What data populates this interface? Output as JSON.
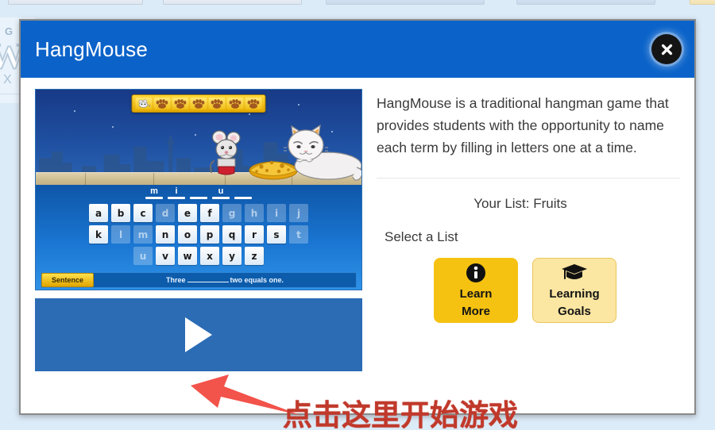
{
  "background": {
    "logo_letter": "W",
    "logo_g": "G",
    "logo_x": "X"
  },
  "modal": {
    "title": "HangMouse",
    "close_icon": "close-x-icon",
    "header_color": "#0b63c9"
  },
  "left_panel": {
    "preview": {
      "lives": [
        {
          "type": "mouse-icon"
        },
        {
          "type": "paw-icon"
        },
        {
          "type": "paw-icon"
        },
        {
          "type": "paw-icon"
        },
        {
          "type": "paw-icon"
        },
        {
          "type": "paw-icon"
        },
        {
          "type": "paw-icon"
        }
      ],
      "word_slots": [
        "m",
        "i",
        "",
        "u",
        ""
      ],
      "keyboard": [
        [
          {
            "letter": "a",
            "used": false
          },
          {
            "letter": "b",
            "used": false
          },
          {
            "letter": "c",
            "used": false
          },
          {
            "letter": "d",
            "used": true
          },
          {
            "letter": "e",
            "used": false
          },
          {
            "letter": "f",
            "used": false
          },
          {
            "letter": "g",
            "used": true
          },
          {
            "letter": "h",
            "used": true
          },
          {
            "letter": "i",
            "used": true
          },
          {
            "letter": "j",
            "used": true
          }
        ],
        [
          {
            "letter": "k",
            "used": false
          },
          {
            "letter": "l",
            "used": true
          },
          {
            "letter": "m",
            "used": true
          },
          {
            "letter": "n",
            "used": false
          },
          {
            "letter": "o",
            "used": false
          },
          {
            "letter": "p",
            "used": false
          },
          {
            "letter": "q",
            "used": false
          },
          {
            "letter": "r",
            "used": false
          },
          {
            "letter": "s",
            "used": false
          },
          {
            "letter": "t",
            "used": true
          }
        ],
        [
          {
            "letter": "u",
            "used": true
          },
          {
            "letter": "v",
            "used": false
          },
          {
            "letter": "w",
            "used": false
          },
          {
            "letter": "x",
            "used": false
          },
          {
            "letter": "y",
            "used": false
          },
          {
            "letter": "z",
            "used": false
          }
        ]
      ],
      "sentence_button_label": "Sentence",
      "sentence_prefix": "Three",
      "sentence_suffix": "two equals one."
    },
    "play_button": {
      "icon": "play-triangle-icon"
    }
  },
  "right_panel": {
    "description": "HangMouse is a traditional hangman game that provides students with the opportunity to name each term by filling in letters one at a time.",
    "your_list": "Your List: Fruits",
    "select_a_list": "Select a List",
    "buttons": [
      {
        "icon": "info-circle-icon",
        "line1": "Learn",
        "line2": "More",
        "style": "solid",
        "color": "#f5c211"
      },
      {
        "icon": "graduation-cap-icon",
        "line1": "Learning",
        "line2": "Goals",
        "style": "light",
        "color": "#fbe6a2"
      }
    ]
  },
  "annotation": {
    "text": "点击这里开始游戏",
    "color": "#c0392b",
    "arrow_icon": "red-arrow-icon"
  }
}
